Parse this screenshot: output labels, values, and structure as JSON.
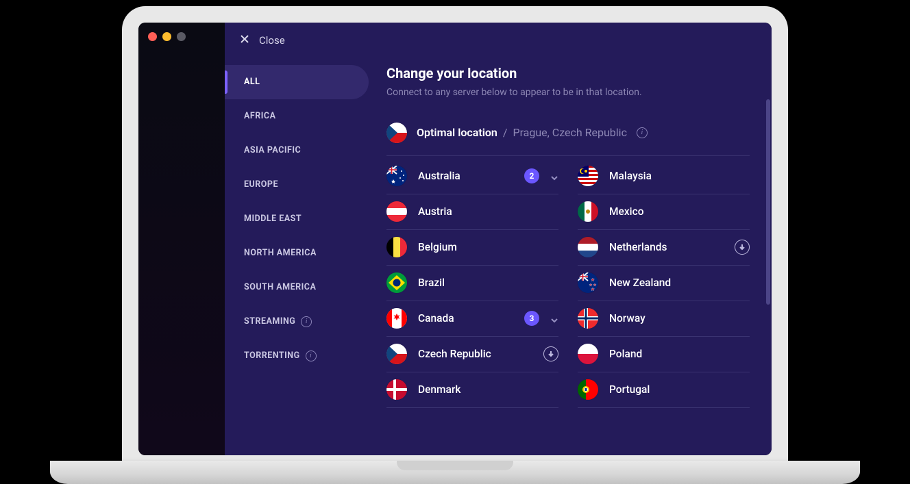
{
  "close_label": "Close",
  "sidebar": {
    "items": [
      {
        "label": "ALL",
        "active": true,
        "info": false
      },
      {
        "label": "AFRICA",
        "active": false,
        "info": false
      },
      {
        "label": "ASIA PACIFIC",
        "active": false,
        "info": false
      },
      {
        "label": "EUROPE",
        "active": false,
        "info": false
      },
      {
        "label": "MIDDLE EAST",
        "active": false,
        "info": false
      },
      {
        "label": "NORTH AMERICA",
        "active": false,
        "info": false
      },
      {
        "label": "SOUTH AMERICA",
        "active": false,
        "info": false
      },
      {
        "label": "STREAMING",
        "active": false,
        "info": true
      },
      {
        "label": "TORRENTING",
        "active": false,
        "info": true
      }
    ]
  },
  "heading": "Change your location",
  "subheading": "Connect to any server below to appear to be in that location.",
  "optimal": {
    "label": "Optimal location",
    "separator": "/",
    "value": "Prague, Czech Republic",
    "flag": "cz"
  },
  "locations_col1": [
    {
      "name": "Australia",
      "flag": "au",
      "badge": "2",
      "chevron": true
    },
    {
      "name": "Austria",
      "flag": "at"
    },
    {
      "name": "Belgium",
      "flag": "be"
    },
    {
      "name": "Brazil",
      "flag": "br"
    },
    {
      "name": "Canada",
      "flag": "ca",
      "badge": "3",
      "chevron": true
    },
    {
      "name": "Czech Republic",
      "flag": "cz",
      "download": true
    },
    {
      "name": "Denmark",
      "flag": "dk"
    }
  ],
  "locations_col2": [
    {
      "name": "Malaysia",
      "flag": "my"
    },
    {
      "name": "Mexico",
      "flag": "mx"
    },
    {
      "name": "Netherlands",
      "flag": "nl",
      "download": true
    },
    {
      "name": "New Zealand",
      "flag": "nz"
    },
    {
      "name": "Norway",
      "flag": "no"
    },
    {
      "name": "Poland",
      "flag": "pl"
    },
    {
      "name": "Portugal",
      "flag": "pt"
    }
  ]
}
